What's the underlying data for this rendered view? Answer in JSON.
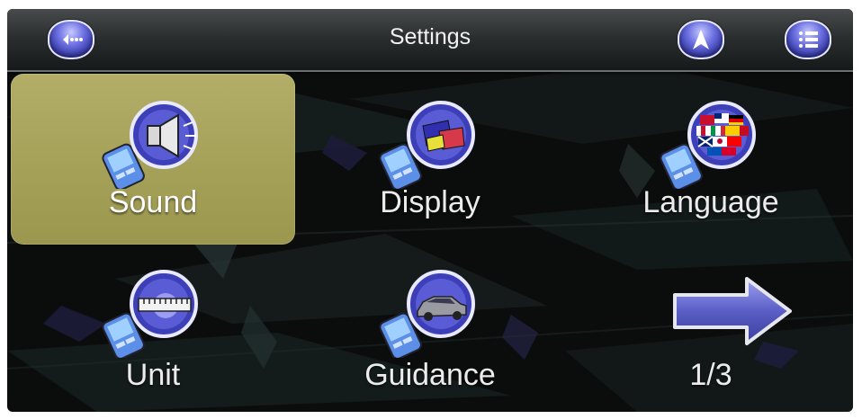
{
  "header": {
    "title": "Settings",
    "back_icon": "back-icon",
    "nav_icon": "navigation-arrow-icon",
    "menu_icon": "list-menu-icon"
  },
  "tiles": [
    {
      "label": "Sound",
      "icon": "speaker-icon",
      "selected": true
    },
    {
      "label": "Display",
      "icon": "display-icon",
      "selected": false
    },
    {
      "label": "Language",
      "icon": "flags-icon",
      "selected": false
    },
    {
      "label": "Unit",
      "icon": "ruler-icon",
      "selected": false
    },
    {
      "label": "Guidance",
      "icon": "car-icon",
      "selected": false
    }
  ],
  "pagination": {
    "page_label": "1/3",
    "next_icon": "next-arrow-icon"
  },
  "colors": {
    "selected_tile": "#a6a25a",
    "icon_accent": "#4b4fd0",
    "background": "#0b0d0d"
  }
}
